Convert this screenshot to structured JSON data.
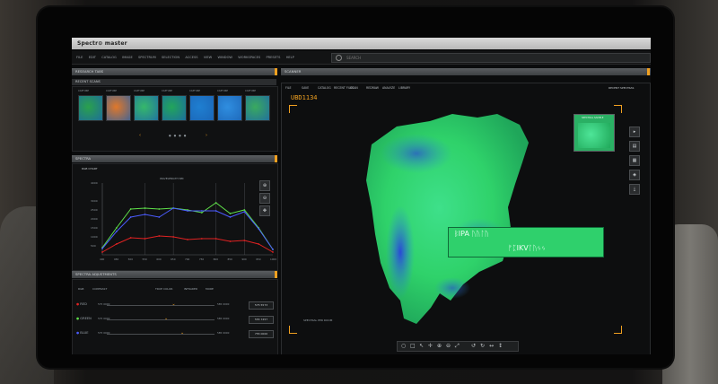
{
  "app": {
    "title": "Spectr⊙ master"
  },
  "menu": [
    "FILE",
    "EDIT",
    "CATALOG",
    "IMAGE",
    "SPECTRUM",
    "SELECTION",
    "ACCESS",
    "VIEW",
    "WINDOW",
    "WORKSPACES",
    "PRESETS",
    "HELP"
  ],
  "search": {
    "placeholder": "SEARCH"
  },
  "left": {
    "research_header": "RESEARCH TABS",
    "scans_header": "RECENT SCANS",
    "thumbs": [
      {
        "caption": "CAPTURE",
        "color": "#2aa14c"
      },
      {
        "caption": "CAPTURE",
        "color": "#e0782a"
      },
      {
        "caption": "CAPTURE",
        "color": "#36b86a"
      },
      {
        "caption": "CAPTURE",
        "color": "#22a55a"
      },
      {
        "caption": "CAPTURE",
        "color": "#1f7fd1"
      },
      {
        "caption": "CAPTURE",
        "color": "#2f8ee0"
      },
      {
        "caption": "CAPTURE",
        "color": "#3aaa5e"
      }
    ],
    "spectra_header": "SPECTRA",
    "rgb_chart_label": "RGB CHART",
    "chart_annotation": "WAVELENGTH NM",
    "adjust_header": "SPECTRA ADJUSTMENTS",
    "adjust_tabs": [
      "RGB",
      "CONTRAST",
      "TRUE COLOR",
      "INFRARED",
      "MORE"
    ],
    "sliders": [
      {
        "label": "RED",
        "min": "575 0000",
        "max": "585 0000",
        "value": "575 5573",
        "pos": 0.62
      },
      {
        "label": "GREEN",
        "min": "575 0000",
        "max": "585 0000",
        "value": "555 7457",
        "pos": 0.55
      },
      {
        "label": "BLUE",
        "min": "575 0000",
        "max": "585 0000",
        "value": "755 0000",
        "pos": 0.7
      }
    ]
  },
  "right": {
    "header": "SCANNER",
    "submenu": [
      "FILE",
      "SAVE",
      "CATALOG",
      "RECENT FILES",
      "SCAN",
      "REDRAW",
      "ANALYZE",
      "LIBRARY"
    ],
    "recent_label": "RECENT SPECTRAS",
    "scan_id": "UBD1134",
    "inset_label": "SPECTRAL SAMPLE",
    "script_line1": "ᛒIPA ᚢᚢᛚᚢ",
    "script_line2": "ᚠᛈIKVᛚᚢᛃᛃ",
    "footer_label": "SPECTRAL PER ROOM"
  },
  "chart_data": {
    "type": "line",
    "title": "RGB CHART",
    "categories": [
      "400",
      "450",
      "500",
      "550",
      "600",
      "650",
      "700",
      "750",
      "800",
      "850",
      "900",
      "950",
      "1000"
    ],
    "ylim": [
      0,
      4000
    ],
    "yticks": [
      "4000",
      "3000",
      "2500",
      "2000",
      "1500",
      "1000",
      "500"
    ],
    "series": [
      {
        "name": "GREEN",
        "color": "#5fe04a",
        "values": [
          400,
          1500,
          2550,
          2600,
          2550,
          2600,
          2500,
          2350,
          2900,
          2300,
          2500,
          1500,
          300
        ]
      },
      {
        "name": "BLUE",
        "color": "#4b5cff",
        "values": [
          350,
          1300,
          2100,
          2250,
          2100,
          2600,
          2450,
          2450,
          2450,
          2100,
          2400,
          1450,
          300
        ]
      },
      {
        "name": "RED",
        "color": "#e02222",
        "values": [
          150,
          600,
          950,
          900,
          1050,
          1000,
          850,
          900,
          900,
          750,
          800,
          600,
          150
        ]
      }
    ]
  }
}
